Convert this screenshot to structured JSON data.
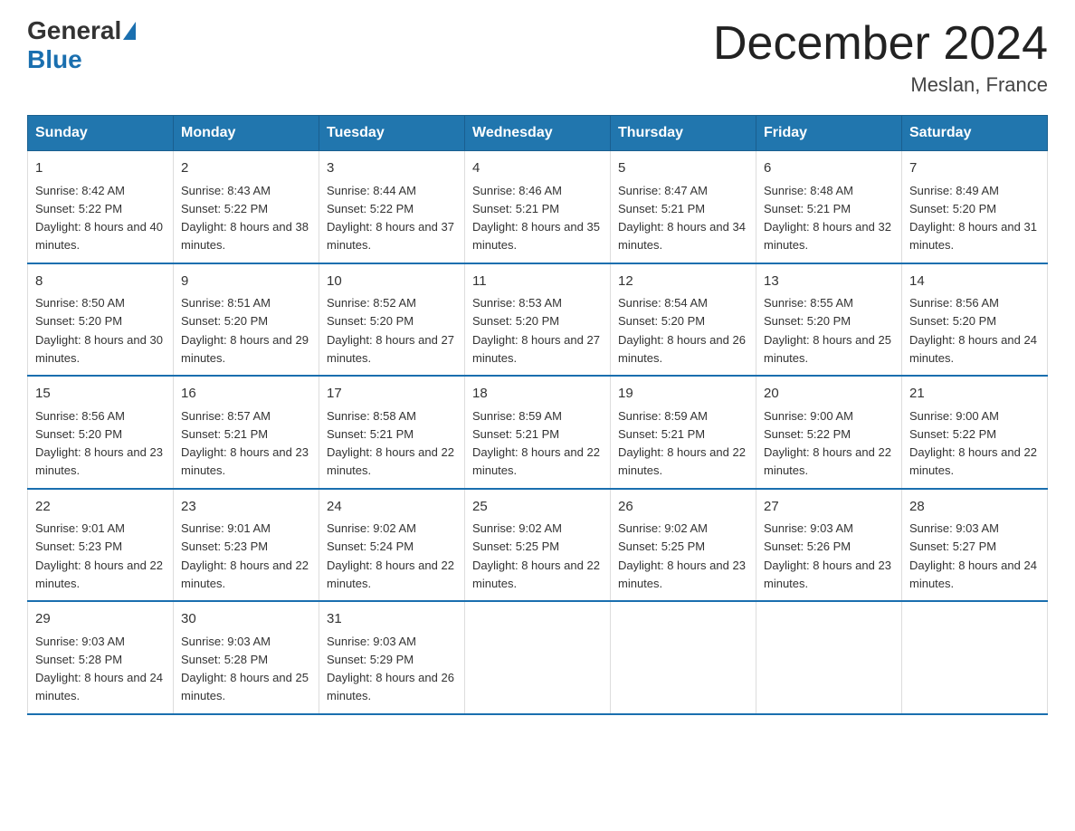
{
  "header": {
    "logo_general": "General",
    "logo_blue": "Blue",
    "month_title": "December 2024",
    "location": "Meslan, France"
  },
  "weekdays": [
    "Sunday",
    "Monday",
    "Tuesday",
    "Wednesday",
    "Thursday",
    "Friday",
    "Saturday"
  ],
  "weeks": [
    [
      {
        "day": "1",
        "sunrise": "8:42 AM",
        "sunset": "5:22 PM",
        "daylight": "8 hours and 40 minutes."
      },
      {
        "day": "2",
        "sunrise": "8:43 AM",
        "sunset": "5:22 PM",
        "daylight": "8 hours and 38 minutes."
      },
      {
        "day": "3",
        "sunrise": "8:44 AM",
        "sunset": "5:22 PM",
        "daylight": "8 hours and 37 minutes."
      },
      {
        "day": "4",
        "sunrise": "8:46 AM",
        "sunset": "5:21 PM",
        "daylight": "8 hours and 35 minutes."
      },
      {
        "day": "5",
        "sunrise": "8:47 AM",
        "sunset": "5:21 PM",
        "daylight": "8 hours and 34 minutes."
      },
      {
        "day": "6",
        "sunrise": "8:48 AM",
        "sunset": "5:21 PM",
        "daylight": "8 hours and 32 minutes."
      },
      {
        "day": "7",
        "sunrise": "8:49 AM",
        "sunset": "5:20 PM",
        "daylight": "8 hours and 31 minutes."
      }
    ],
    [
      {
        "day": "8",
        "sunrise": "8:50 AM",
        "sunset": "5:20 PM",
        "daylight": "8 hours and 30 minutes."
      },
      {
        "day": "9",
        "sunrise": "8:51 AM",
        "sunset": "5:20 PM",
        "daylight": "8 hours and 29 minutes."
      },
      {
        "day": "10",
        "sunrise": "8:52 AM",
        "sunset": "5:20 PM",
        "daylight": "8 hours and 27 minutes."
      },
      {
        "day": "11",
        "sunrise": "8:53 AM",
        "sunset": "5:20 PM",
        "daylight": "8 hours and 27 minutes."
      },
      {
        "day": "12",
        "sunrise": "8:54 AM",
        "sunset": "5:20 PM",
        "daylight": "8 hours and 26 minutes."
      },
      {
        "day": "13",
        "sunrise": "8:55 AM",
        "sunset": "5:20 PM",
        "daylight": "8 hours and 25 minutes."
      },
      {
        "day": "14",
        "sunrise": "8:56 AM",
        "sunset": "5:20 PM",
        "daylight": "8 hours and 24 minutes."
      }
    ],
    [
      {
        "day": "15",
        "sunrise": "8:56 AM",
        "sunset": "5:20 PM",
        "daylight": "8 hours and 23 minutes."
      },
      {
        "day": "16",
        "sunrise": "8:57 AM",
        "sunset": "5:21 PM",
        "daylight": "8 hours and 23 minutes."
      },
      {
        "day": "17",
        "sunrise": "8:58 AM",
        "sunset": "5:21 PM",
        "daylight": "8 hours and 22 minutes."
      },
      {
        "day": "18",
        "sunrise": "8:59 AM",
        "sunset": "5:21 PM",
        "daylight": "8 hours and 22 minutes."
      },
      {
        "day": "19",
        "sunrise": "8:59 AM",
        "sunset": "5:21 PM",
        "daylight": "8 hours and 22 minutes."
      },
      {
        "day": "20",
        "sunrise": "9:00 AM",
        "sunset": "5:22 PM",
        "daylight": "8 hours and 22 minutes."
      },
      {
        "day": "21",
        "sunrise": "9:00 AM",
        "sunset": "5:22 PM",
        "daylight": "8 hours and 22 minutes."
      }
    ],
    [
      {
        "day": "22",
        "sunrise": "9:01 AM",
        "sunset": "5:23 PM",
        "daylight": "8 hours and 22 minutes."
      },
      {
        "day": "23",
        "sunrise": "9:01 AM",
        "sunset": "5:23 PM",
        "daylight": "8 hours and 22 minutes."
      },
      {
        "day": "24",
        "sunrise": "9:02 AM",
        "sunset": "5:24 PM",
        "daylight": "8 hours and 22 minutes."
      },
      {
        "day": "25",
        "sunrise": "9:02 AM",
        "sunset": "5:25 PM",
        "daylight": "8 hours and 22 minutes."
      },
      {
        "day": "26",
        "sunrise": "9:02 AM",
        "sunset": "5:25 PM",
        "daylight": "8 hours and 23 minutes."
      },
      {
        "day": "27",
        "sunrise": "9:03 AM",
        "sunset": "5:26 PM",
        "daylight": "8 hours and 23 minutes."
      },
      {
        "day": "28",
        "sunrise": "9:03 AM",
        "sunset": "5:27 PM",
        "daylight": "8 hours and 24 minutes."
      }
    ],
    [
      {
        "day": "29",
        "sunrise": "9:03 AM",
        "sunset": "5:28 PM",
        "daylight": "8 hours and 24 minutes."
      },
      {
        "day": "30",
        "sunrise": "9:03 AM",
        "sunset": "5:28 PM",
        "daylight": "8 hours and 25 minutes."
      },
      {
        "day": "31",
        "sunrise": "9:03 AM",
        "sunset": "5:29 PM",
        "daylight": "8 hours and 26 minutes."
      },
      null,
      null,
      null,
      null
    ]
  ],
  "labels": {
    "sunrise": "Sunrise:",
    "sunset": "Sunset:",
    "daylight": "Daylight:"
  }
}
